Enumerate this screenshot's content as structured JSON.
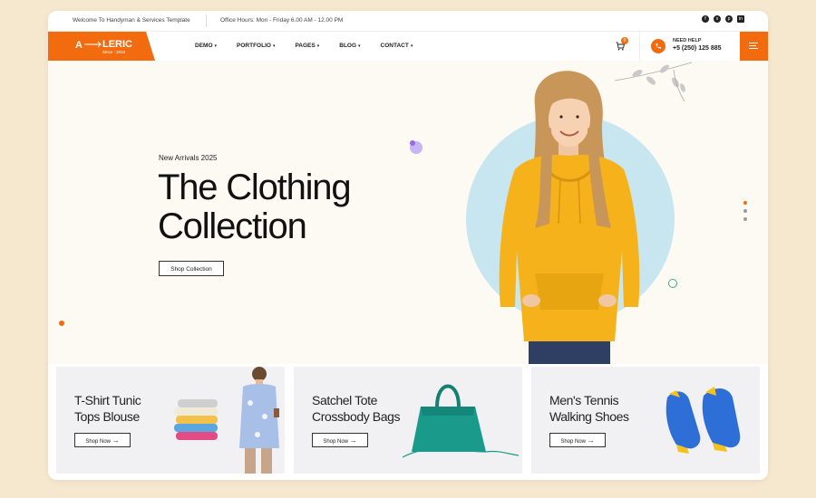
{
  "topbar": {
    "welcome": "Welcome To Handyman & Services Template",
    "hours": "Office Hours: Mon - Friday 6.00 AM - 12.00 PM",
    "social_icons": [
      "facebook-icon",
      "x-icon",
      "pinterest-icon",
      "linkedin-icon"
    ]
  },
  "nav": {
    "logo_text": "LERIC",
    "logo_since": "Since : 2018",
    "menu": [
      {
        "label": "DEMO",
        "caret": "▾"
      },
      {
        "label": "PORTFOLIO",
        "caret": "▾"
      },
      {
        "label": "PAGES",
        "caret": "▾"
      },
      {
        "label": "BLOG",
        "caret": "▾"
      },
      {
        "label": "CONTACT",
        "caret": "▾"
      }
    ],
    "cart_count": "0",
    "help_label": "NEED HELP",
    "help_phone": "+5 (250) 125 885"
  },
  "hero": {
    "eyebrow": "New Arrivals 2025",
    "headline_line1": "The Clothing",
    "headline_line2": "Collection",
    "button": "Shop Collection"
  },
  "cards": [
    {
      "line1": "T-Shirt Tunic",
      "line2": "Tops Blouse",
      "button": "Shop Now",
      "arrow": "→"
    },
    {
      "line1": "Satchel Tote",
      "line2": "Crossbody Bags",
      "button": "Shop Now",
      "arrow": "→"
    },
    {
      "line1": "Men's Tennis",
      "line2": "Walking Shoes",
      "button": "Shop Now",
      "arrow": "→"
    }
  ],
  "colors": {
    "accent": "#f26b0f",
    "hoodie": "#f5b21b",
    "circle": "#c8e6f0",
    "bag": "#1a9a8a",
    "shoes": "#2d6fd6"
  }
}
